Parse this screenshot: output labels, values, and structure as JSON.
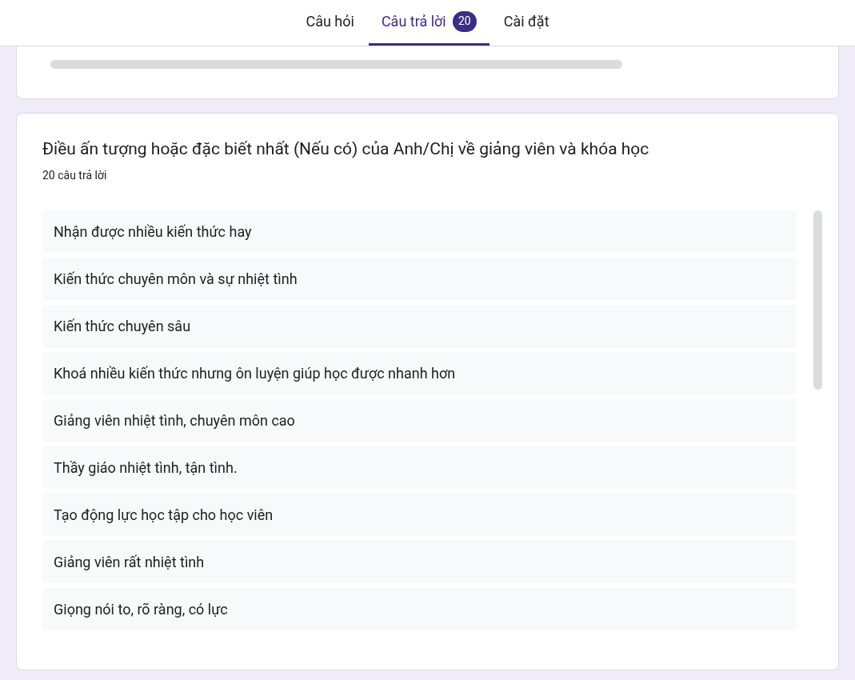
{
  "tabs": [
    {
      "label": "Câu hỏi",
      "selected": false
    },
    {
      "label": "Câu trả lời",
      "selected": true,
      "badge": "20"
    },
    {
      "label": "Cài đặt",
      "selected": false
    }
  ],
  "question": {
    "title": "Điều ấn tượng hoặc đặc biết nhất (Nếu có) của Anh/Chị về giảng viên và khóa học",
    "count": "20 câu trả lời",
    "responses": [
      "Nhận được nhiều kiến thức hay",
      "Kiến thức chuyên môn và sự nhiệt tình",
      "Kiến thức chuyên sâu",
      "Khoá nhiều kiến thức nhưng ôn luyện giúp học được nhanh hơn",
      "Giảng viên nhiệt tình, chuyên môn cao",
      "Thầy giáo nhiệt tình, tận tình.",
      "Tạo động lực học tập cho học viên",
      "Giảng viên rất nhiệt tình",
      "Giọng nói to, rõ ràng, có lực"
    ]
  }
}
